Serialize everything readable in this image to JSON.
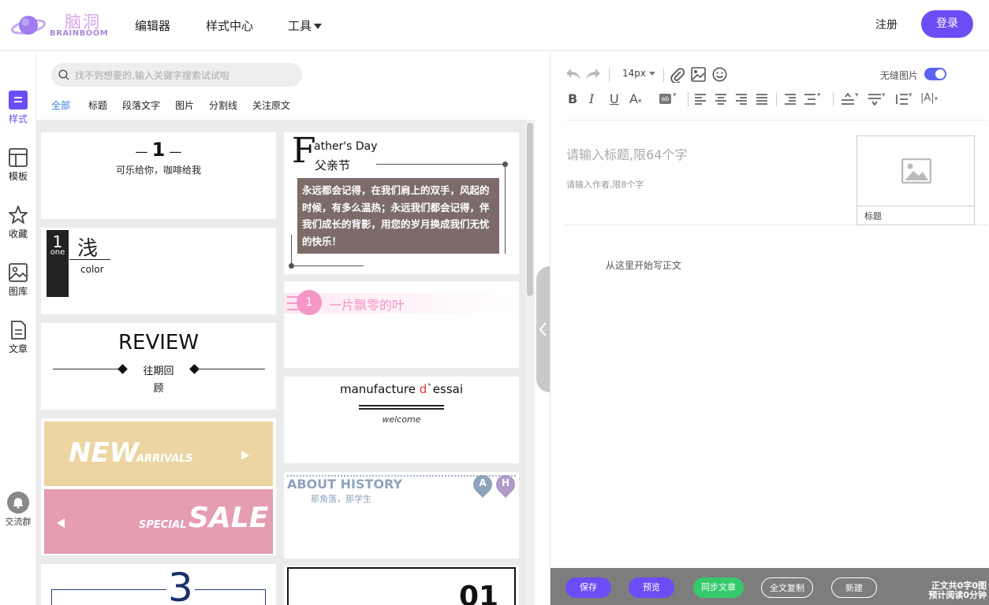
{
  "header": {
    "logo_cn": "脑洞",
    "logo_en": "BRAINBOOM",
    "nav": [
      "编辑器",
      "样式中心",
      "工具"
    ],
    "register": "注册",
    "login": "登录"
  },
  "sidebar": {
    "items": [
      {
        "label": "样式",
        "icon": "style-icon"
      },
      {
        "label": "模板",
        "icon": "template-icon"
      },
      {
        "label": "收藏",
        "icon": "star-icon"
      },
      {
        "label": "图库",
        "icon": "image-icon"
      },
      {
        "label": "文章",
        "icon": "document-icon"
      }
    ],
    "community": "交流群"
  },
  "panel": {
    "search_placeholder": "找不到想要的,输入关键字搜索试试啦",
    "tabs": [
      "全部",
      "标题",
      "段落文字",
      "图片",
      "分割线",
      "关注原文"
    ],
    "cards": {
      "c1_num": "1",
      "c1_text": "可乐给你，咖啡给我",
      "c2_num": "1",
      "c2_one": "one",
      "c2_char": "浅",
      "c2_color": "color",
      "c3_title": "REVIEW",
      "c3_l1": "往期回",
      "c3_l2": "顾",
      "c4_new": "NEW",
      "c4_arrivals": "ARRIVALS",
      "c4_special": "SPECIAL",
      "c4_sale": "SALE",
      "c5_num": "3",
      "f_big": "F",
      "f_en": "ather's Day",
      "f_cn": "父亲节",
      "f_body": "永远都会记得，在我们肩上的双手，风起的时候，有多么温热；永远我们都会记得，伴我们成长的背影，用您的岁月换成我们无忧的快乐！",
      "leaf_num": "1",
      "leaf_text": "一片飘零的叶",
      "m_pre": "manufacture ",
      "m_d": "d",
      "m_post": "`essai",
      "m_welcome": "welcome",
      "about_title": "ABOUT HISTORY",
      "about_sub": "那角落，那学生",
      "pin_a": "A",
      "pin_h": "H",
      "last_num": "01"
    }
  },
  "editor": {
    "font_size": "14px",
    "seamless_label": "无缝图片",
    "seamless_on": true,
    "title_placeholder": "请输入标题,限64个字",
    "author_placeholder": "请输入作者,限8个字",
    "cover_label": "标题",
    "body_placeholder": "从这里开始写正文",
    "buttons": {
      "save": "保存",
      "preview": "预览",
      "sync": "同步文章",
      "copy": "全文复制",
      "new": "新建"
    },
    "stat1": "正文共0字0图",
    "stat2": "预计阅读0分钟"
  },
  "colors": {
    "accent": "#6c4df5",
    "sync_green": "#36c96c",
    "tab_active": "#3b7ce9",
    "father_card": "#7c6b69",
    "new_card": "#ecd5a3",
    "sale_card": "#e59db2",
    "leaf_pink": "#f497c7"
  }
}
